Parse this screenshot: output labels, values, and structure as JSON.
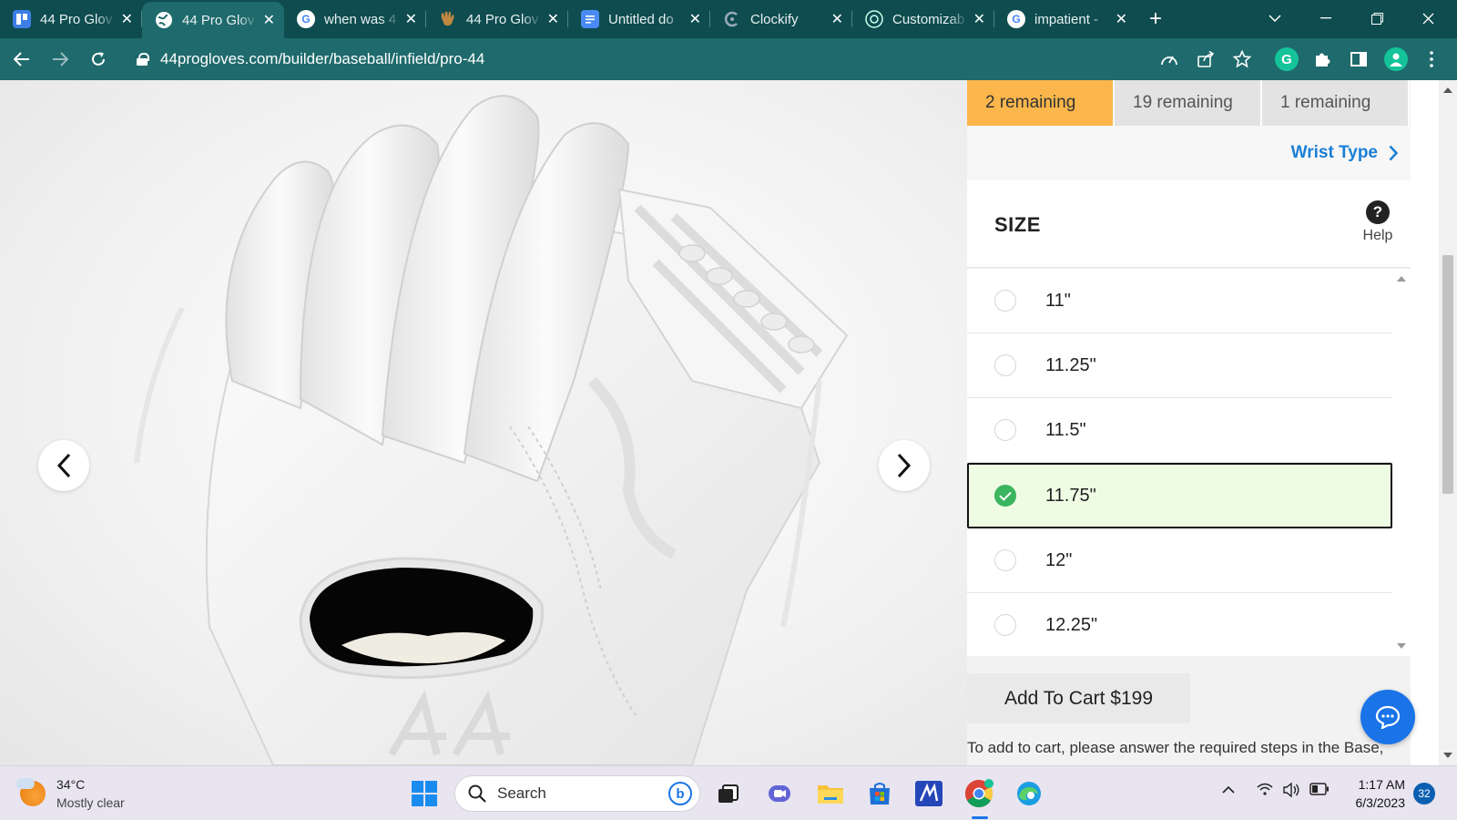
{
  "browser": {
    "tabs": [
      {
        "label": "44 Pro Glov",
        "icon": "trello-icon",
        "color": "#3c7de6",
        "active": false
      },
      {
        "label": "44 Pro Glov",
        "icon": "globe-icon",
        "color": "#ffffff",
        "active": true
      },
      {
        "label": "when was 4",
        "icon": "google-icon",
        "color": "#ffffff",
        "active": false
      },
      {
        "label": "44 Pro Glov",
        "icon": "glove-icon",
        "color": "#b5773a",
        "active": false
      },
      {
        "label": "Untitled do",
        "icon": "docs-icon",
        "color": "#4a8af4",
        "active": false
      },
      {
        "label": "Clockify",
        "icon": "clockify-icon",
        "color": "#ffffff",
        "active": false
      },
      {
        "label": "Customizab",
        "icon": "chatgpt-icon",
        "color": "#ffffff",
        "active": false
      },
      {
        "label": "impatient -",
        "icon": "google-icon",
        "color": "#ffffff",
        "active": false
      }
    ],
    "new_tab": "+",
    "url": "44progloves.com/builder/baseball/infield/pro-44",
    "theme_color": "#1f6a6c",
    "tabstrip_color": "#0e4c4f"
  },
  "builder": {
    "steps": [
      {
        "label": "2 remaining",
        "active": true
      },
      {
        "label": "19 remaining",
        "active": false
      },
      {
        "label": "1 remaining",
        "active": false
      }
    ],
    "next_step": "Wrist Type",
    "section_title": "SIZE",
    "help_label": "Help",
    "size_options": [
      {
        "label": "11\"",
        "selected": false
      },
      {
        "label": "11.25\"",
        "selected": false
      },
      {
        "label": "11.5\"",
        "selected": false
      },
      {
        "label": "11.75\"",
        "selected": true
      },
      {
        "label": "12\"",
        "selected": false
      },
      {
        "label": "12.25\"",
        "selected": false
      }
    ],
    "add_to_cart": "Add To Cart $199",
    "cart_note": "To add to cart, please answer the required steps in the Base,",
    "accent": "#fbb64c",
    "link_color": "#1a7fd6",
    "check_color": "#3bb560"
  },
  "taskbar": {
    "temperature": "34°C",
    "weather": "Mostly clear",
    "search_placeholder": "Search",
    "time": "1:17 AM",
    "date": "6/3/2023",
    "notification_count": "32"
  }
}
